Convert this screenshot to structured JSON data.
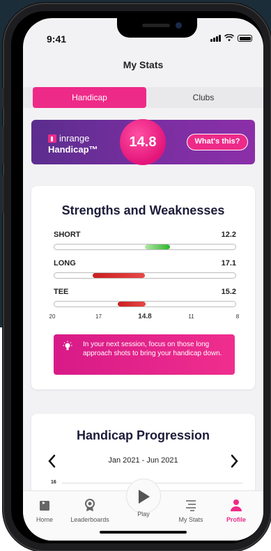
{
  "status_bar": {
    "time": "9:41"
  },
  "header": {
    "title": "My Stats"
  },
  "tabs": [
    {
      "label": "Handicap",
      "active": true
    },
    {
      "label": "Clubs",
      "active": false
    }
  ],
  "handicap_banner": {
    "brand": "inrange",
    "label": "Handicap™",
    "value": "14.8",
    "whats_this_label": "What's this?"
  },
  "strengths": {
    "title": "Strengths and Weaknesses",
    "rows": [
      {
        "name": "SHORT",
        "value": "12.2",
        "color": "#44c43c"
      },
      {
        "name": "LONG",
        "value": "17.1",
        "color": "#d42a2a"
      },
      {
        "name": "TEE",
        "value": "15.2",
        "color": "#d42a2a"
      }
    ],
    "scale": [
      "20",
      "17",
      "14.8",
      "11",
      "8"
    ],
    "tip": "In your next session, focus on those long approach shots to bring your handicap down."
  },
  "progression": {
    "title": "Handicap Progression",
    "range": "Jan 2021 - Jun 2021",
    "axis_top": "16"
  },
  "tabbar": [
    {
      "label": "Home",
      "icon": "home-icon",
      "active": false
    },
    {
      "label": "Leaderboards",
      "icon": "award-icon",
      "active": false
    },
    {
      "label": "Play",
      "icon": "play-icon",
      "active": false
    },
    {
      "label": "My Stats",
      "icon": "stats-icon",
      "active": false
    },
    {
      "label": "Profile",
      "icon": "profile-icon",
      "active": true
    }
  ],
  "colors": {
    "accent": "#ee2a89",
    "banner": "#6b2c97",
    "good": "#44c43c",
    "bad": "#d42a2a"
  }
}
